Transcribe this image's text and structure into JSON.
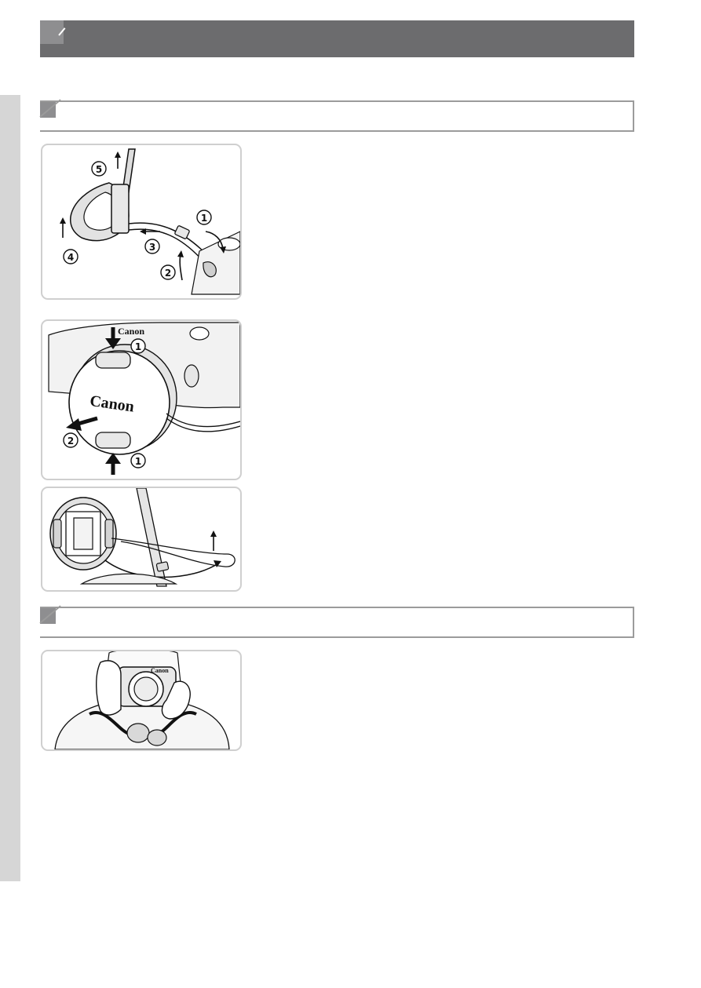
{
  "page": {
    "title": "",
    "sections": [
      {
        "title": ""
      },
      {
        "title": ""
      }
    ]
  },
  "figures": {
    "strap": {
      "labels": [
        "①",
        "②",
        "③",
        "④",
        "⑤"
      ]
    },
    "lens_cap": {
      "brand": "Canon",
      "body_brand": "Canon",
      "labels": [
        "①",
        "②",
        "①"
      ]
    },
    "cap_cord": {
      "labels": []
    },
    "holding": {
      "brand": "Canon"
    }
  },
  "colors": {
    "title_bar": "#6c6c6e",
    "accent_square": "#8e8e90",
    "side_tab": "#d6d6d6",
    "panel_border": "#cfcfcf"
  }
}
